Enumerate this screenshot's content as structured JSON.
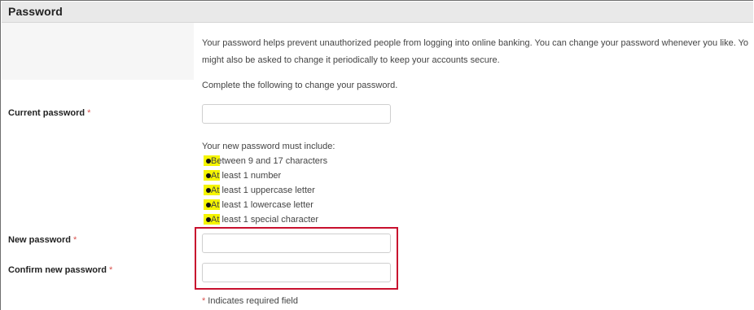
{
  "section": {
    "title": "Password"
  },
  "intro": {
    "line1": "Your password helps prevent unauthorized people from logging into online banking. You can change your password whenever you like. Yo",
    "line2": "might also be asked to change it periodically to keep your accounts secure.",
    "instruction": "Complete the following to change your password."
  },
  "form": {
    "required_mark": "*",
    "current_password": {
      "label": "Current password",
      "value": ""
    },
    "new_password": {
      "label": "New password",
      "value": ""
    },
    "confirm_password": {
      "label": "Confirm new password",
      "value": ""
    }
  },
  "rules": {
    "title": "Your new password must include:",
    "items": [
      "Between 9 and 17 characters",
      "At least 1 number",
      "At least 1 uppercase letter",
      "At least 1 lowercase letter",
      "At least 1 special character"
    ]
  },
  "footer": {
    "required_mark": "*",
    "required_text": "Indicates required field"
  },
  "colors": {
    "highlight": "#f5f500",
    "focus_box": "#c8102e",
    "required": "#d9534f"
  }
}
